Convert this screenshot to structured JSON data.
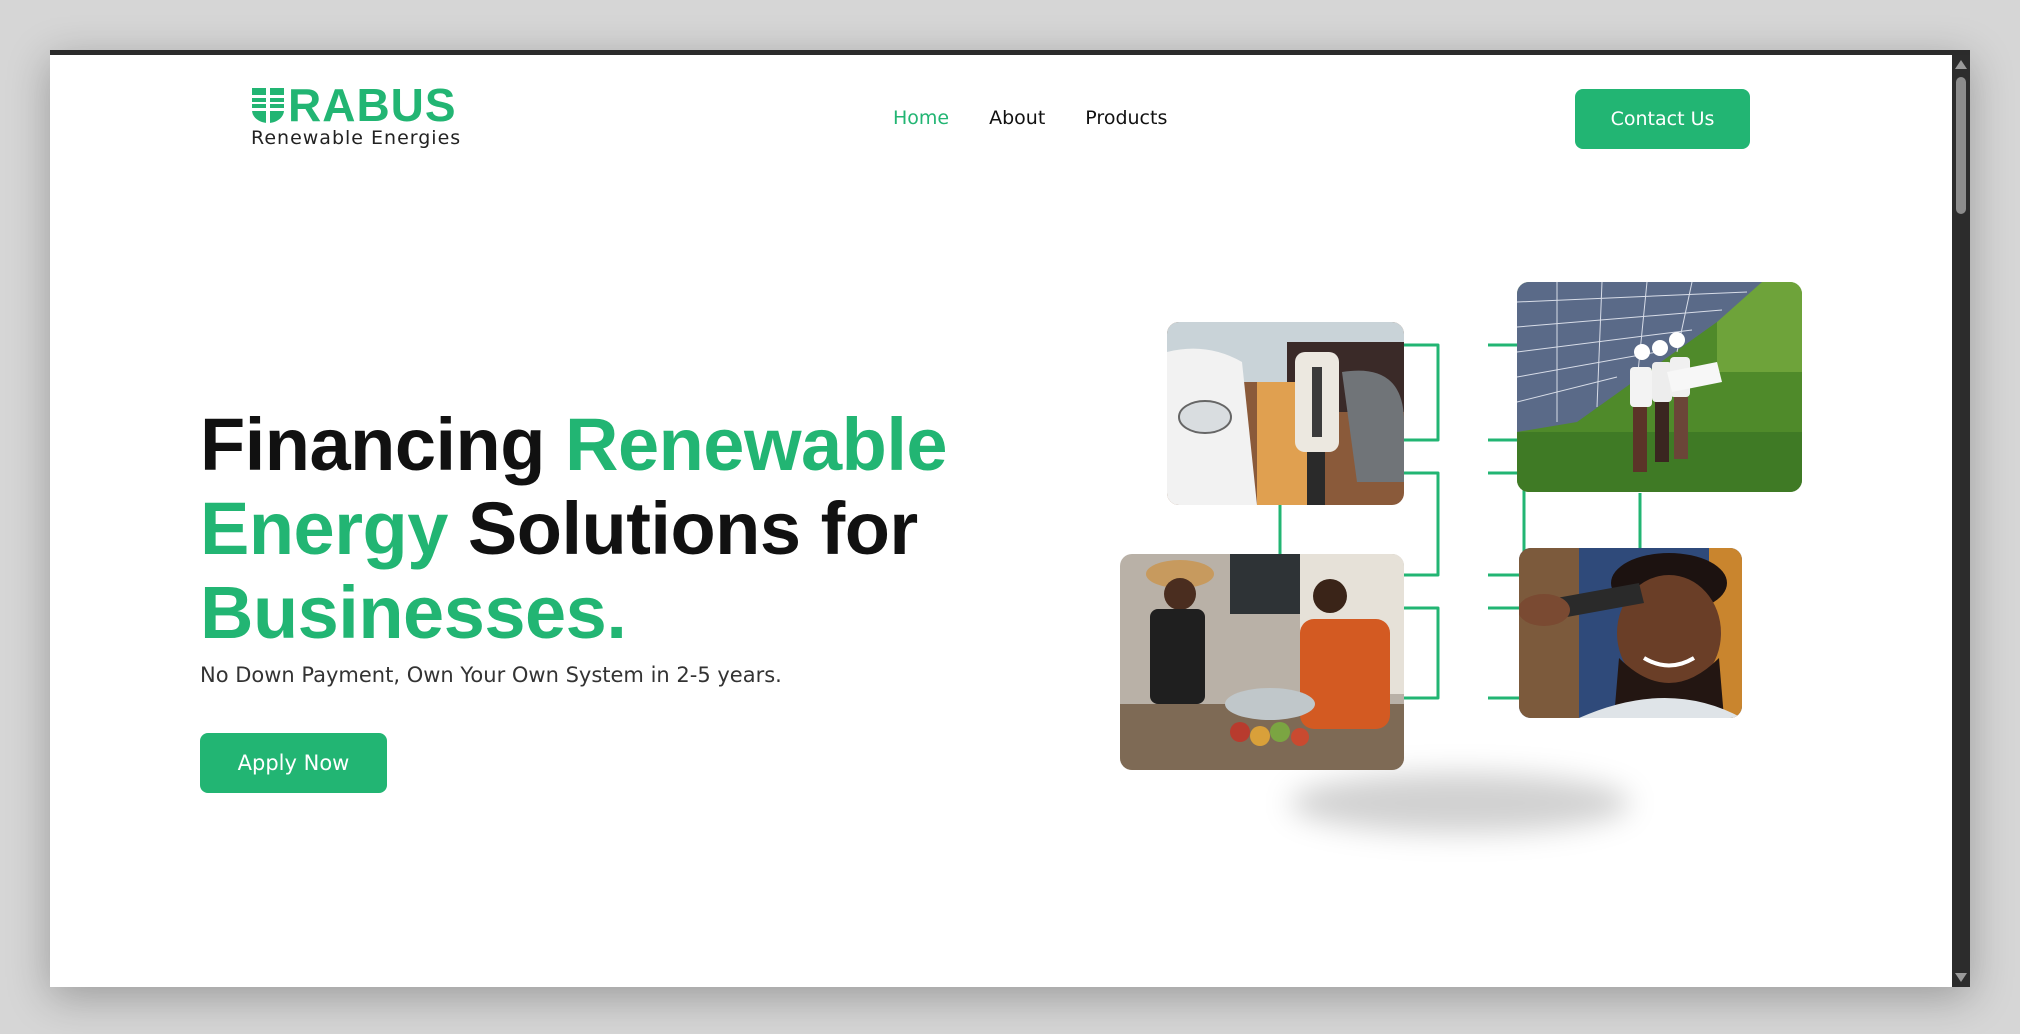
{
  "brand": {
    "name": "RABUS",
    "tagline": "Renewable Energies",
    "accent_color": "#22b573",
    "text_color": "#111111"
  },
  "nav": {
    "links": [
      {
        "label": "Home",
        "active": true
      },
      {
        "label": "About",
        "active": false
      },
      {
        "label": "Products",
        "active": false
      }
    ],
    "contact_label": "Contact Us"
  },
  "hero": {
    "title_part1": "Financing ",
    "title_green1": "Renewable",
    "title_green2": "Energy",
    "title_part2": " Solutions for",
    "title_green3": "Businesses.",
    "subtitle": "No Down Payment, Own Your Own System in 2-5 years.",
    "cta_label": "Apply Now"
  },
  "collage": {
    "photos": [
      {
        "subject": "electric-car-charging"
      },
      {
        "subject": "engineers-at-solar-panels"
      },
      {
        "subject": "market-shop-checkout"
      },
      {
        "subject": "barber-haircut"
      }
    ]
  },
  "icons": [
    "solar-panel-logo-icon",
    "scroll-up-arrow-icon",
    "scroll-down-arrow-icon"
  ]
}
